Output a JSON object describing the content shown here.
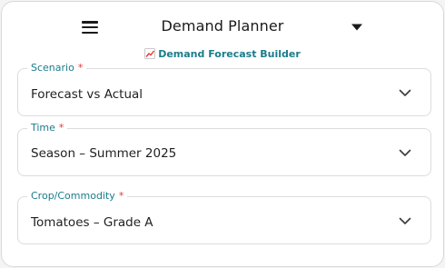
{
  "header": {
    "title": "Demand Planner",
    "menu_icon": "hamburger-menu-icon",
    "dropdown_icon": "caret-down-icon"
  },
  "subtitle": {
    "icon": "chart-increasing-icon",
    "text": "Demand Forecast Builder"
  },
  "form": {
    "fields": [
      {
        "label": "Scenario",
        "required_mark": "*",
        "value": "Forecast vs Actual"
      },
      {
        "label": "Time",
        "required_mark": "*",
        "value": "Season – Summer 2025"
      },
      {
        "label": "Crop/Commodity",
        "required_mark": "*",
        "value": "Tomatoes – Grade A"
      }
    ]
  },
  "colors": {
    "accent": "#1b7c8a",
    "required": "#e53935",
    "border": "#dcdcdc",
    "text": "#1f1f1f"
  }
}
